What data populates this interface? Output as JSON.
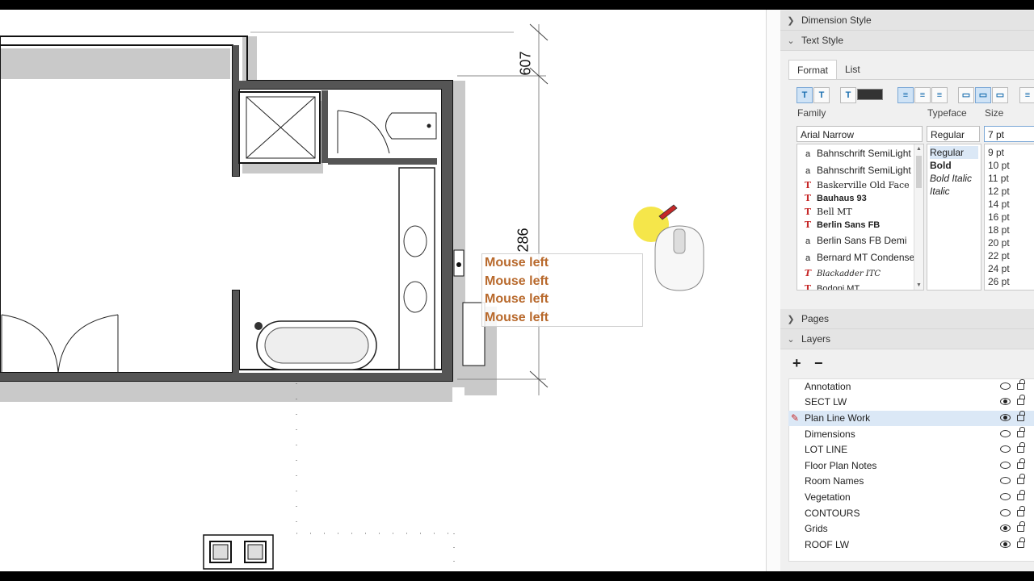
{
  "panel": {
    "dimension_style": "Dimension Style",
    "text_style": "Text Style",
    "tabs": [
      "Format",
      "List"
    ],
    "family_label": "Family",
    "typeface_label": "Typeface",
    "size_label": "Size",
    "family_value": "Arial Narrow",
    "typeface_value": "Regular",
    "size_value": "7 pt",
    "fonts": [
      {
        "name": "Bahnschrift SemiLight C",
        "icon": "opentype-icon"
      },
      {
        "name": "Bahnschrift SemiLight S",
        "icon": "opentype-icon"
      },
      {
        "name": "Baskerville Old Face",
        "icon": "truetype-icon"
      },
      {
        "name": "Bauhaus 93",
        "icon": "truetype-icon"
      },
      {
        "name": "Bell MT",
        "icon": "truetype-icon"
      },
      {
        "name": "Berlin Sans FB",
        "icon": "truetype-icon"
      },
      {
        "name": "Berlin Sans FB Demi",
        "icon": "opentype-icon"
      },
      {
        "name": "Bernard MT Condensed",
        "icon": "opentype-icon"
      },
      {
        "name": "Blackadder ITC",
        "icon": "truetype-icon"
      },
      {
        "name": "Bodoni MT",
        "icon": "truetype-icon"
      }
    ],
    "typefaces": [
      "Regular",
      "Bold",
      "Bold Italic",
      "Italic"
    ],
    "sizes": [
      "9 pt",
      "10 pt",
      "11 pt",
      "12 pt",
      "14 pt",
      "16 pt",
      "18 pt",
      "20 pt",
      "22 pt",
      "24 pt",
      "26 pt"
    ],
    "text_color": "#333333",
    "pages": "Pages",
    "layers": "Layers",
    "add_label": "+",
    "remove_label": "−",
    "layer_items": [
      {
        "name": "Annotation",
        "visible": false
      },
      {
        "name": "SECT LW",
        "visible": true
      },
      {
        "name": "Plan Line Work",
        "visible": true,
        "active": true
      },
      {
        "name": "Dimensions",
        "visible": false
      },
      {
        "name": "LOT LINE",
        "visible": false
      },
      {
        "name": "Floor Plan Notes",
        "visible": false
      },
      {
        "name": "Room Names",
        "visible": false
      },
      {
        "name": "Vegetation",
        "visible": false
      },
      {
        "name": "CONTOURS",
        "visible": false
      },
      {
        "name": "Grids",
        "visible": true
      },
      {
        "name": "ROOF LW",
        "visible": true
      }
    ]
  },
  "canvas": {
    "dim_top": "607",
    "dim_right": "286",
    "mouse_note": [
      "Mouse left",
      "Mouse left",
      "Mouse left",
      "Mouse left"
    ]
  }
}
